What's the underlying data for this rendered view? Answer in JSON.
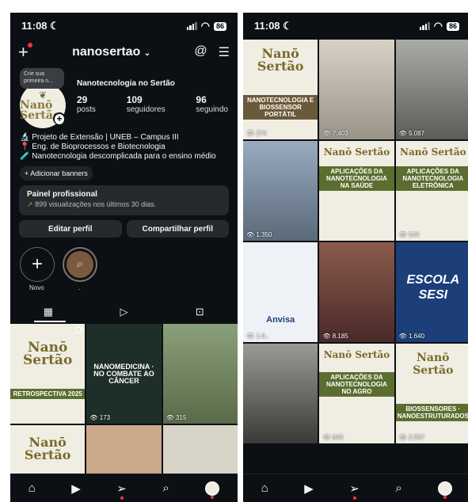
{
  "status": {
    "time": "11:08 ☾",
    "battery": "86"
  },
  "profile": {
    "username": "nanosertao",
    "note": "Crie sua primeira n...",
    "name": "Nanotecnologia no Sertão",
    "stats": [
      {
        "count": "29",
        "label": "posts"
      },
      {
        "count": "109",
        "label": "seguidores"
      },
      {
        "count": "96",
        "label": "seguindo"
      }
    ],
    "bio": [
      "🔬 Projeto de Extensão | UNEB – Campus III",
      "📍 Eng. de Bioprocessos e Biotecnologia",
      "🧪 Nanotecnologia descomplicada para o ensino médio"
    ],
    "add_banners": "+ Adicionar banners",
    "panel_title": "Painel profissional",
    "panel_sub": "899 visualizações nos últimos 30 dias.",
    "edit_btn": "Editar perfil",
    "share_btn": "Compartilhar perfil",
    "highlight_new": "Novo",
    "highlight_other": "."
  },
  "logo_text": "Nanō Sertão",
  "left_grid": [
    {
      "caption": "RETROSPECTIVA 2025",
      "views": "",
      "bg": "#f0ede3"
    },
    {
      "caption": "NANOMEDICINA · NO COMBATE AO CÂNCER",
      "views": "173",
      "bg": "#1e2f2a"
    },
    {
      "caption": "",
      "views": "315",
      "bg": "#6a7a5a"
    },
    {
      "caption": "",
      "views": "",
      "bg": "#f0ede3"
    },
    {
      "caption": "",
      "views": "",
      "bg": "#c9a98a"
    },
    {
      "caption": "",
      "views": "",
      "bg": "#d8d4c8"
    }
  ],
  "right_grid": [
    {
      "caption": "NANOTECNOLOGIA E BIOSSENSOR PORTÁTIL",
      "views": "274",
      "bg": "#f0ede3"
    },
    {
      "caption": "",
      "views": "7.403",
      "bg": "#b9b3a6"
    },
    {
      "caption": "",
      "views": "5.087",
      "bg": "#8b8f86"
    },
    {
      "caption": "",
      "views": "1.350",
      "bg": "#7a8a9a"
    },
    {
      "caption": "APLICAÇÕES DA NANOTECNOLOGIA NA SAÚDE",
      "views": "",
      "bg": "#f0ede3"
    },
    {
      "caption": "APLICAÇÕES DA NANOTECNOLOGIA ELETRÔNICA",
      "views": "534",
      "bg": "#f0ede3"
    },
    {
      "caption": "Anvisa",
      "views": "1.0..",
      "bg": "#eef2f6"
    },
    {
      "caption": "",
      "views": "8.185",
      "bg": "#6a4a3a"
    },
    {
      "caption": "ESCOLA SESI",
      "views": "1.640",
      "bg": "#1c3f7a"
    },
    {
      "caption": "",
      "views": "",
      "bg": "#6f6e6a"
    },
    {
      "caption": "APLICAÇÕES DA NANOTECNOLOGIA NO AGRO",
      "views": "849",
      "bg": "#f0ede3"
    },
    {
      "caption": "BIOSSENSORES · NANOESTRUTURADOS",
      "views": "2.597",
      "bg": "#f0ede3"
    }
  ],
  "colors": {
    "bg": "#0c1014",
    "panel": "#26292e",
    "accent_green": "#5b6e2f",
    "notify": "#ff3040"
  },
  "icons": [
    "plus-icon",
    "threads-icon",
    "menu-icon",
    "grid-icon",
    "reels-icon",
    "tagged-icon",
    "home-icon",
    "reels-nav-icon",
    "send-icon",
    "search-icon",
    "avatar-icon"
  ]
}
